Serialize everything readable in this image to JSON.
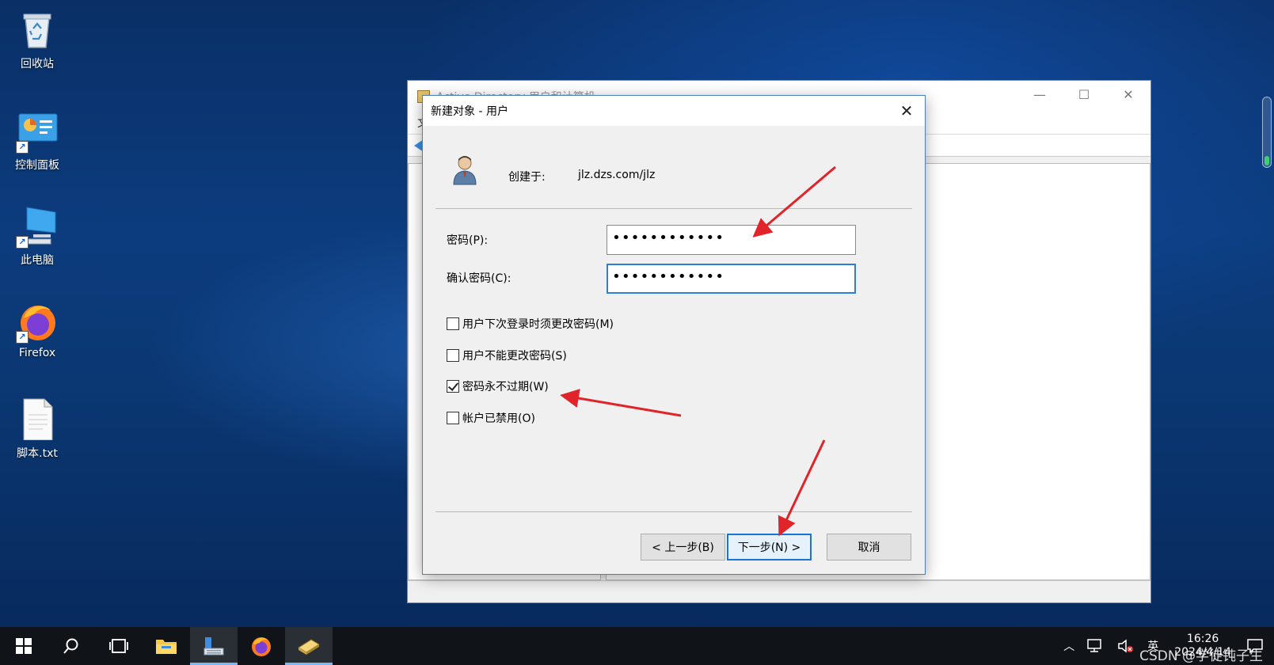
{
  "desktop": {
    "icons": [
      {
        "label": "回收站"
      },
      {
        "label": "控制面板"
      },
      {
        "label": "此电脑"
      },
      {
        "label": "Firefox"
      },
      {
        "label": "脚本.txt"
      }
    ]
  },
  "ad_window": {
    "title": "Active Directory 用户和计算机",
    "menu_first": "文"
  },
  "dialog": {
    "title": "新建对象 - 用户",
    "created_in_label": "创建于:",
    "created_in_value": "jlz.dzs.com/jlz",
    "password_label": "密码(P):",
    "password_value": "••••••••••••",
    "confirm_label": "确认密码(C):",
    "confirm_value": "••••••••••••",
    "options": [
      {
        "label": "用户下次登录时须更改密码(M)",
        "checked": false
      },
      {
        "label": "用户不能更改密码(S)",
        "checked": false
      },
      {
        "label": "密码永不过期(W)",
        "checked": true
      },
      {
        "label": "帐户已禁用(O)",
        "checked": false
      }
    ],
    "buttons": {
      "back": "< 上一步(B)",
      "next": "下一步(N) >",
      "cancel": "取消"
    }
  },
  "taskbar": {
    "ime": "英",
    "time": "16:26",
    "date": "2024/4/14"
  },
  "watermark": "CSDN @学徒钝子生",
  "colors": {
    "annotation_arrow": "#e0242a",
    "focus_border": "#2b7fd6"
  }
}
